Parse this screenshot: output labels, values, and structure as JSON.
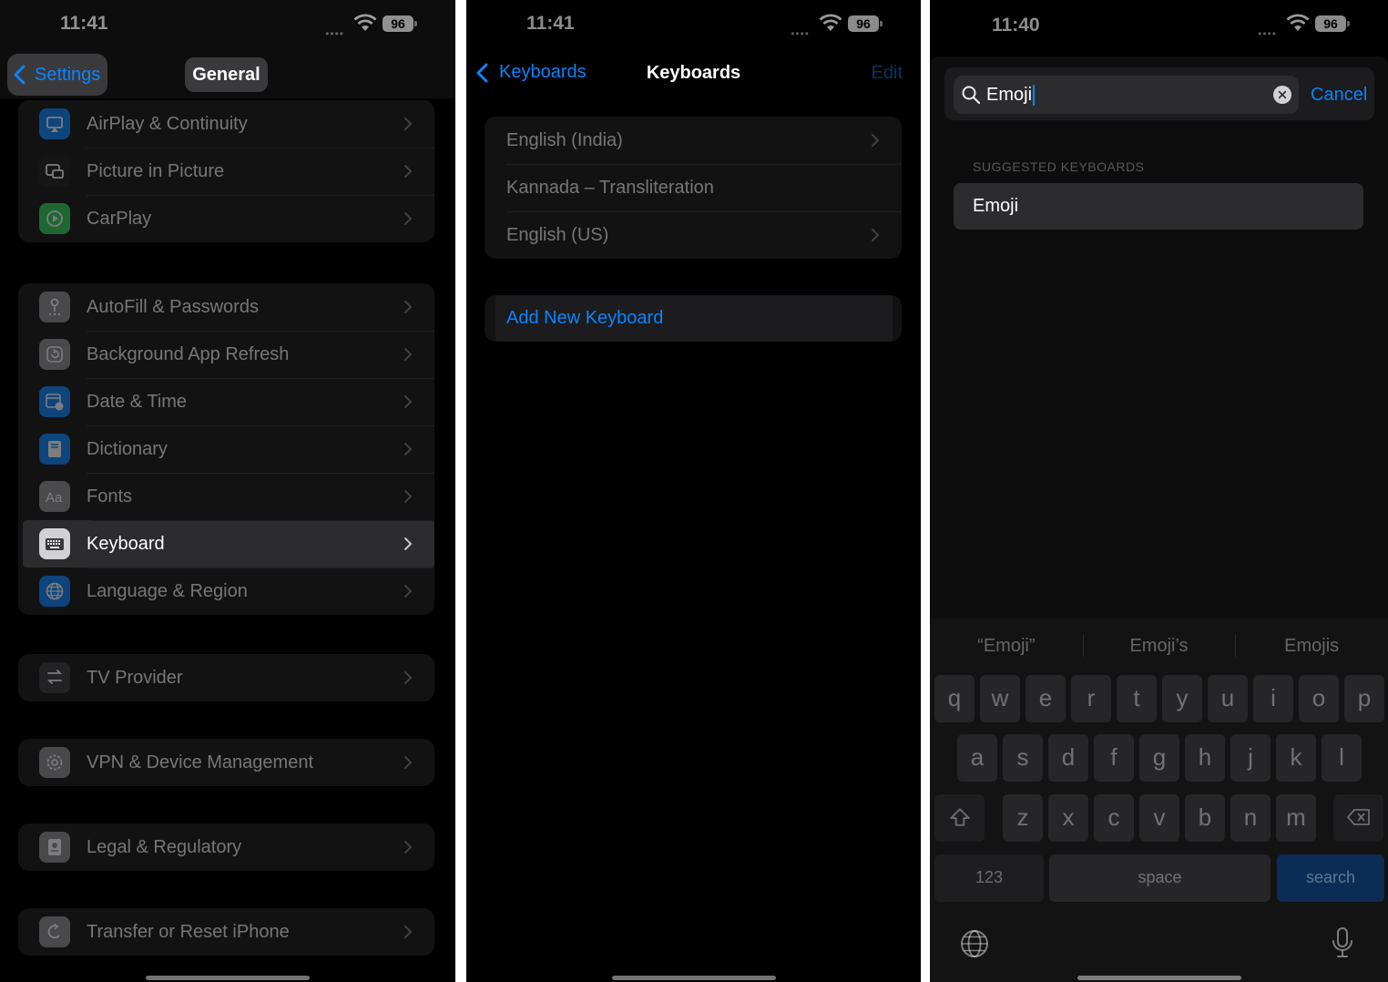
{
  "panel1": {
    "status": {
      "time": "11:41",
      "battery": "96"
    },
    "nav": {
      "back_label": "Settings",
      "title": "General"
    },
    "group1": [
      {
        "label": "AirPlay & Continuity",
        "icon": "airplay-icon",
        "color": "#0a84ff"
      },
      {
        "label": "Picture in Picture",
        "icon": "pip-icon",
        "color": "#1c1c1e"
      },
      {
        "label": "CarPlay",
        "icon": "carplay-icon",
        "color": "#30d158"
      }
    ],
    "group2": [
      {
        "label": "AutoFill & Passwords",
        "icon": "key-icon",
        "color": "#8e8e93"
      },
      {
        "label": "Background App Refresh",
        "icon": "refresh-icon",
        "color": "#8e8e93"
      },
      {
        "label": "Date & Time",
        "icon": "calendar-icon",
        "color": "#0a84ff"
      },
      {
        "label": "Dictionary",
        "icon": "book-icon",
        "color": "#0a84ff"
      },
      {
        "label": "Fonts",
        "icon": "fonts-icon",
        "color": "#8e8e93"
      },
      {
        "label": "Keyboard",
        "icon": "keyboard-icon",
        "color": "#d1d1d6",
        "active": true
      },
      {
        "label": "Language & Region",
        "icon": "globe-icon",
        "color": "#0a84ff"
      }
    ],
    "group3": [
      {
        "label": "TV Provider",
        "icon": "tv-provider-icon",
        "color": "#3a3a3c"
      }
    ],
    "group4": [
      {
        "label": "VPN & Device Management",
        "icon": "gear-icon",
        "color": "#8e8e93"
      }
    ],
    "group5": [
      {
        "label": "Legal & Regulatory",
        "icon": "legal-icon",
        "color": "#8e8e93"
      }
    ],
    "group6": [
      {
        "label": "Transfer or Reset iPhone",
        "icon": "reset-icon",
        "color": "#8e8e93"
      }
    ]
  },
  "panel2": {
    "status": {
      "time": "11:41",
      "battery": "96"
    },
    "nav": {
      "back_label": "Keyboards",
      "title": "Keyboards",
      "edit_label": "Edit"
    },
    "keyboards": [
      {
        "label": "English (India)",
        "chevron": true
      },
      {
        "label": "Kannada – Transliteration",
        "chevron": false
      },
      {
        "label": "English (US)",
        "chevron": true
      }
    ],
    "add_label": "Add New Keyboard"
  },
  "panel3": {
    "status": {
      "time": "11:40",
      "battery": "96"
    },
    "search": {
      "value": "Emoji",
      "cancel_label": "Cancel"
    },
    "section_header": "SUGGESTED KEYBOARDS",
    "suggestion": "Emoji",
    "predictions": [
      "“Emoji”",
      "Emoji’s",
      "Emojis"
    ],
    "keyboard": {
      "row1": [
        "q",
        "w",
        "e",
        "r",
        "t",
        "y",
        "u",
        "i",
        "o",
        "p"
      ],
      "row2": [
        "a",
        "s",
        "d",
        "f",
        "g",
        "h",
        "j",
        "k",
        "l"
      ],
      "row3": [
        "z",
        "x",
        "c",
        "v",
        "b",
        "n",
        "m"
      ],
      "numbers_label": "123",
      "space_label": "space",
      "search_label": "search"
    }
  },
  "colors": {
    "accent": "#0a84ff",
    "background": "#000000"
  }
}
